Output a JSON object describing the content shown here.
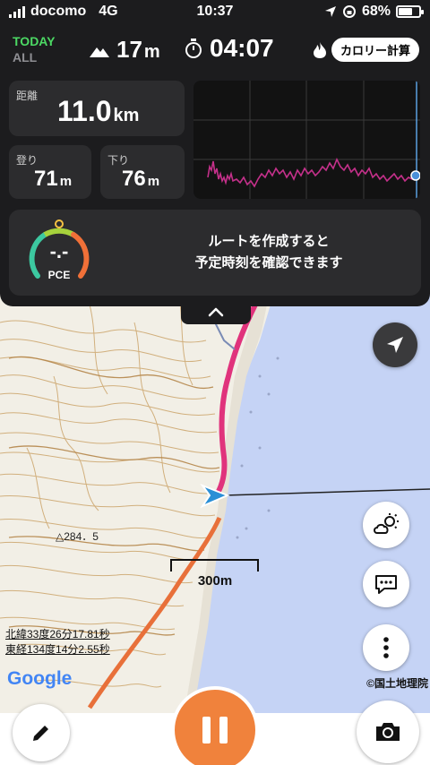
{
  "status": {
    "carrier": "docomo",
    "network": "4G",
    "time": "10:37",
    "battery": "68%",
    "battery_fraction": 0.68,
    "location_icon": "location-arrow-icon",
    "rotation_lock_icon": "rotation-lock-icon"
  },
  "header": {
    "today_label": "TODAY",
    "all_label": "ALL",
    "altitude_value": "17",
    "altitude_unit": "m",
    "elapsed_time": "04:07",
    "calorie_button": "カロリー計算",
    "accent_today": "#4cd964"
  },
  "stats": {
    "distance_label": "距離",
    "distance_value": "11.0",
    "distance_unit": "km",
    "ascent_label": "登り",
    "ascent_value": "71",
    "ascent_unit": "m",
    "descent_label": "下り",
    "descent_value": "76",
    "descent_unit": "m"
  },
  "pce": {
    "value": "-.-",
    "label": "PCE",
    "message_line1": "ルートを作成すると",
    "message_line2": "予定時刻を確認できます"
  },
  "map": {
    "peak_label": "△284．5",
    "scale_label": "300m",
    "lat": "北緯33度26分17.81秒",
    "lon": "東経134度14分2.55秒",
    "google": "Google",
    "copyright": "©国土地理院",
    "route_color": "#e0337c",
    "sea_color": "#c5d3f5"
  },
  "buttons": {
    "locate_icon": "navigation-arrow-icon",
    "weather_icon": "weather-icon",
    "chat_icon": "chat-bubble-icon",
    "more_icon": "more-vertical-icon",
    "edit_icon": "pencil-icon",
    "camera_icon": "camera-icon",
    "pause_color": "#f0823c",
    "collapse_icon": "chevron-up-icon"
  }
}
